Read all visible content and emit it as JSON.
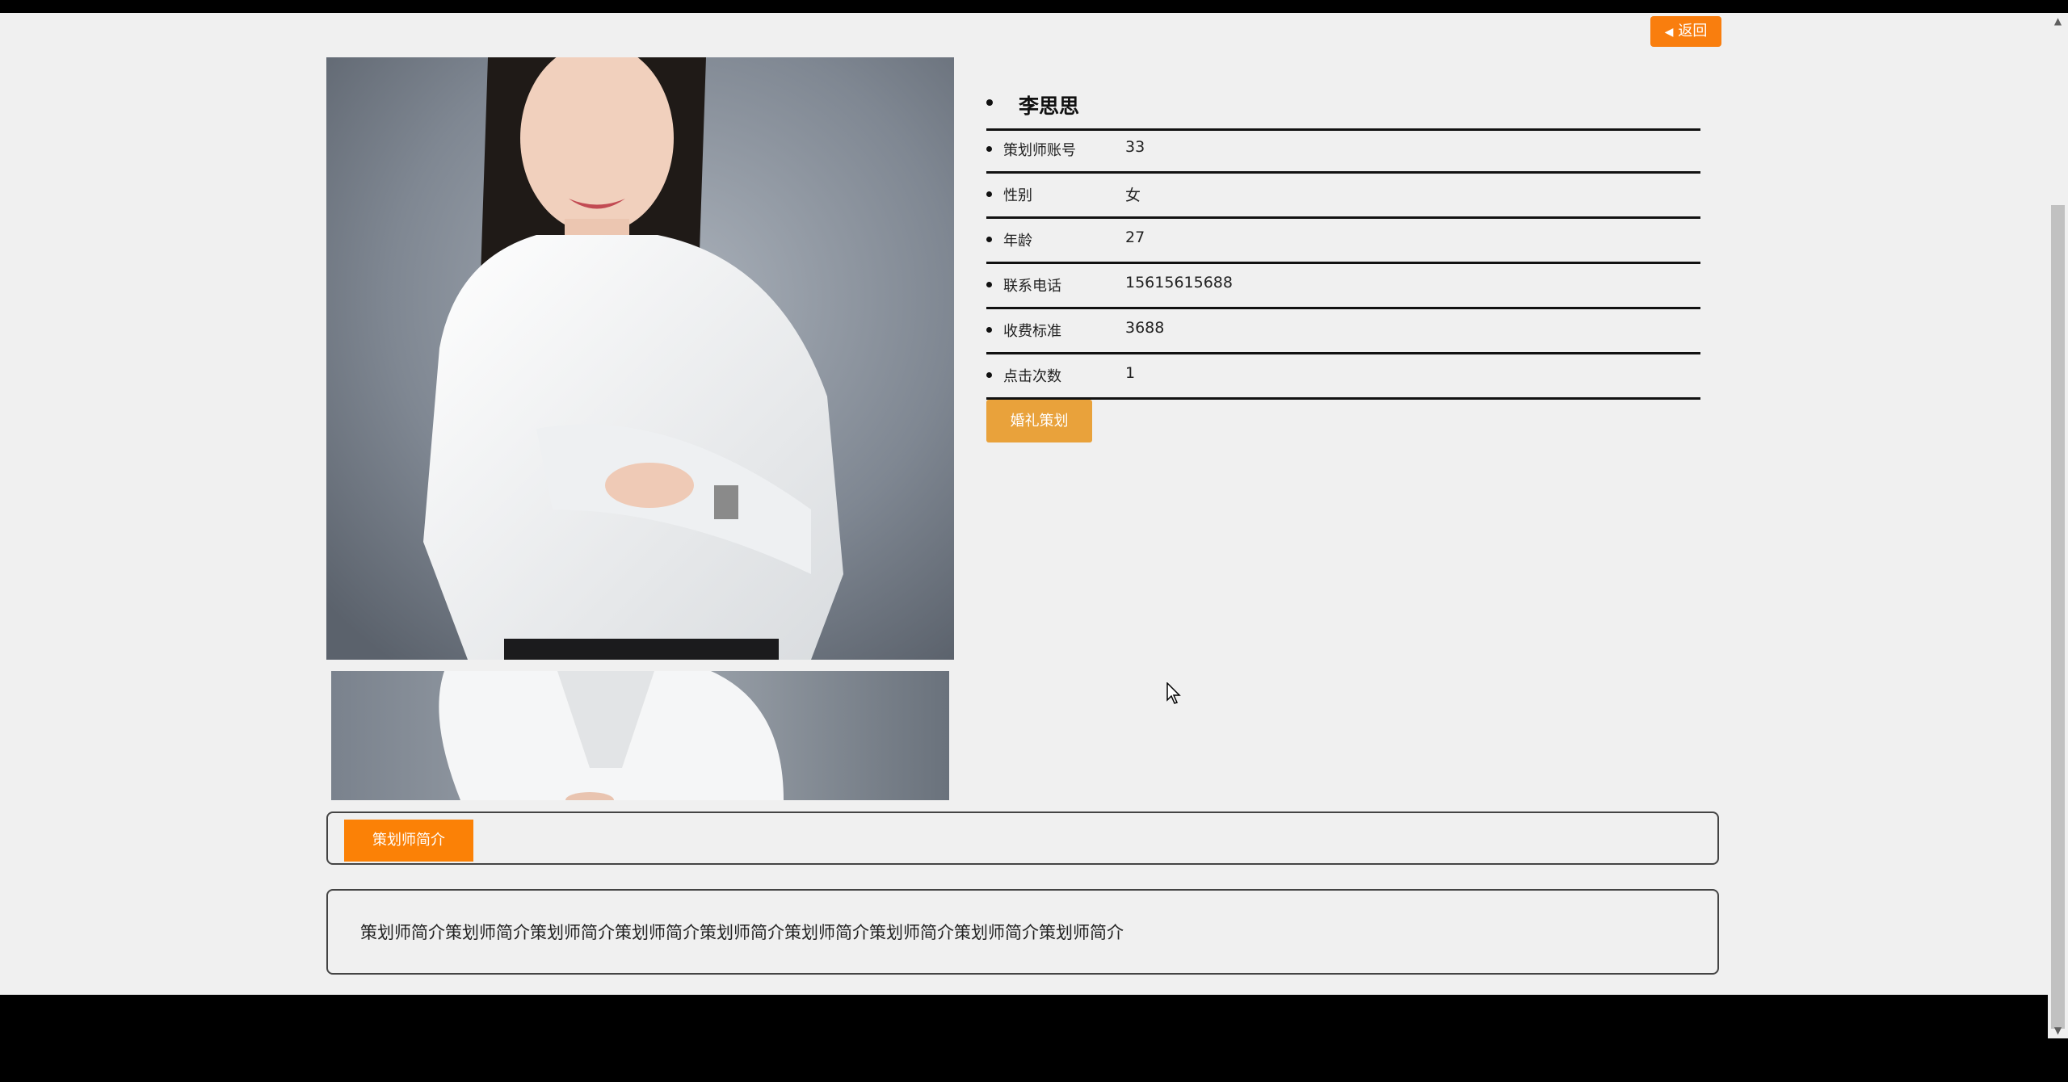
{
  "header": {
    "back_label": "返回"
  },
  "planner": {
    "name": "李思思",
    "fields": [
      {
        "label": "策划师账号",
        "value": "33"
      },
      {
        "label": "性别",
        "value": "女"
      },
      {
        "label": "年龄",
        "value": "27"
      },
      {
        "label": "联系电话",
        "value": "15615615688"
      },
      {
        "label": "收费标准",
        "value": "3688"
      },
      {
        "label": "点击次数",
        "value": "1"
      }
    ],
    "action_label": "婚礼策划"
  },
  "intro": {
    "tab_label": "策划师简介",
    "text": "策划师简介策划师简介策划师简介策划师简介策划师简介策划师简介策划师简介策划师简介策划师简介"
  },
  "colors": {
    "accent_orange": "#f97e0e",
    "button_gold": "#e9a23b",
    "page_bg": "#f0f0f0"
  },
  "icons": [
    "caret-left-icon",
    "cursor-icon"
  ]
}
